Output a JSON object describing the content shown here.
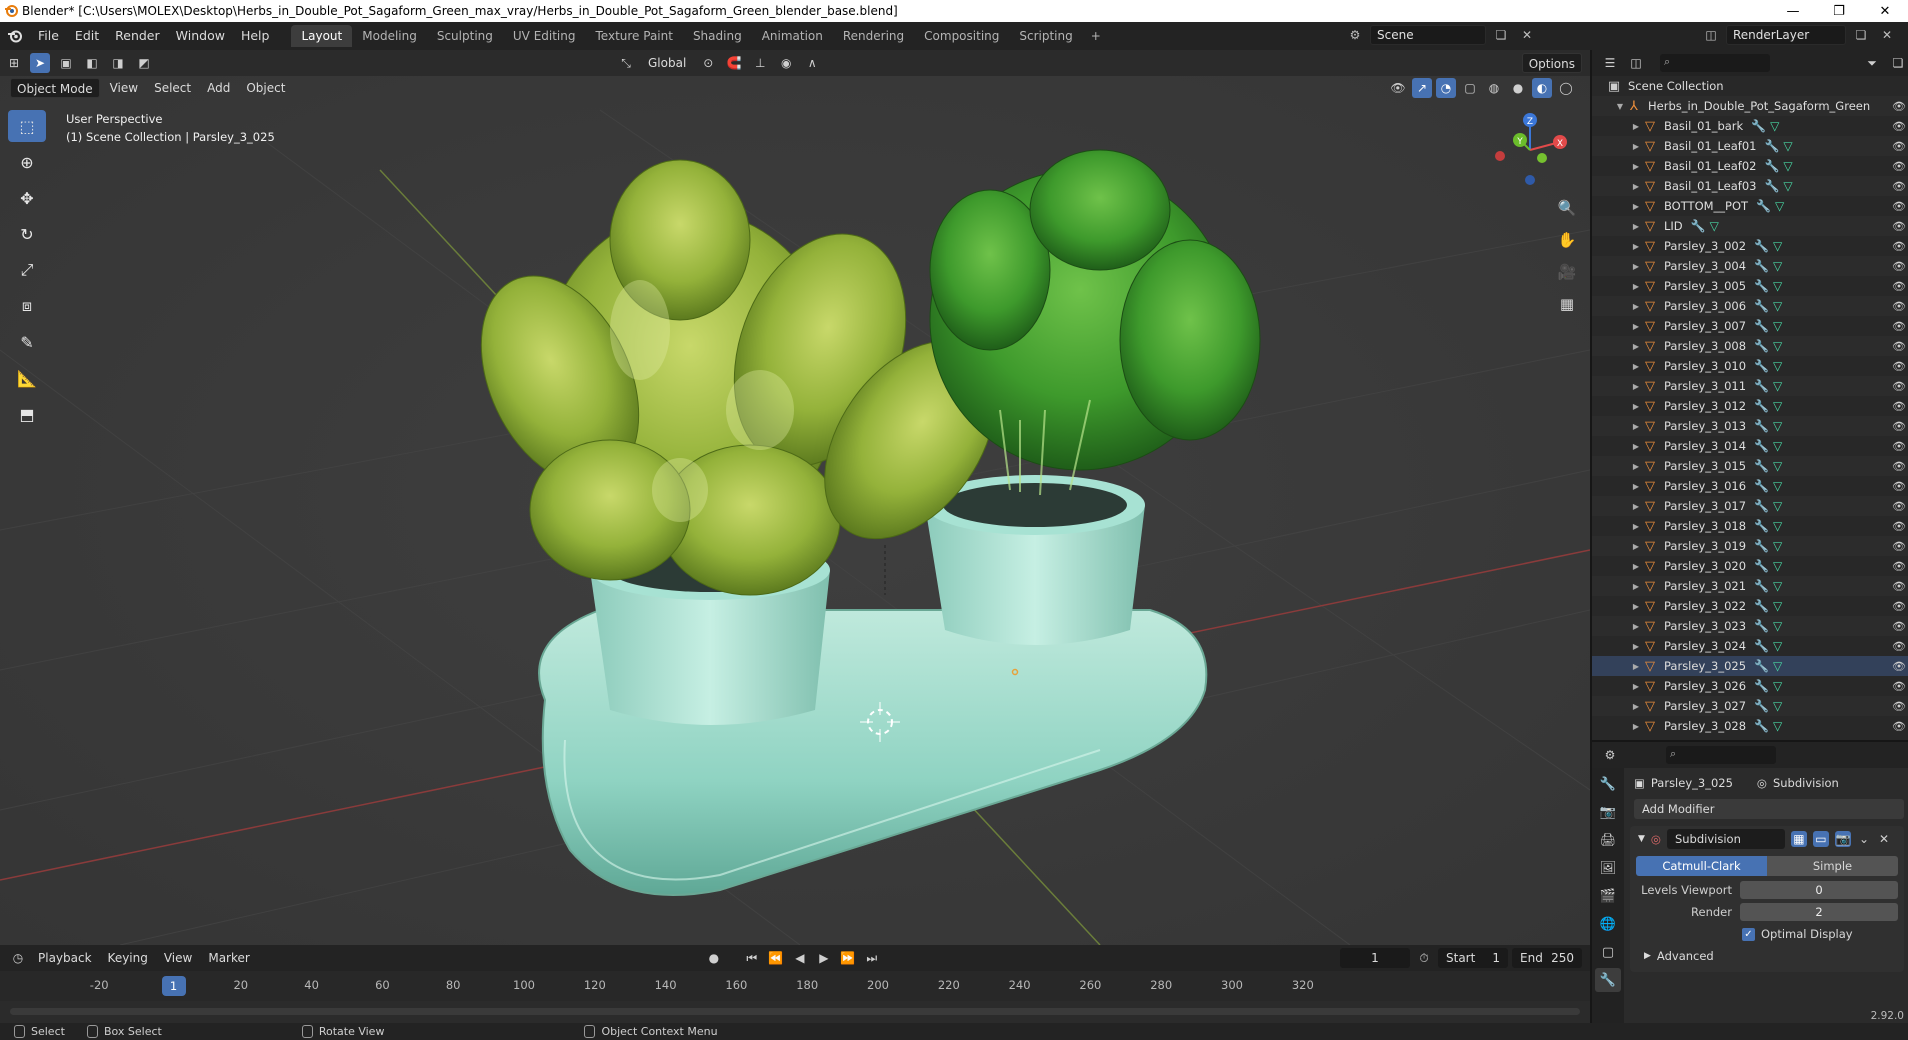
{
  "window": {
    "title": "Blender* [C:\\Users\\MOLEX\\Desktop\\Herbs_in_Double_Pot_Sagaform_Green_max_vray/Herbs_in_Double_Pot_Sagaform_Green_blender_base.blend]",
    "minimize": "—",
    "maximize": "❐",
    "close": "✕"
  },
  "menu": [
    "File",
    "Edit",
    "Render",
    "Window",
    "Help"
  ],
  "workspaces": [
    "Layout",
    "Modeling",
    "Sculpting",
    "UV Editing",
    "Texture Paint",
    "Shading",
    "Animation",
    "Rendering",
    "Compositing",
    "Scripting"
  ],
  "workspace_add": "+",
  "scene": {
    "name": "Scene",
    "render_layer": "RenderLayer"
  },
  "viewport": {
    "mode": "Object Mode",
    "menus": [
      "View",
      "Select",
      "Add",
      "Object"
    ],
    "transform_orientation": "Global",
    "options": "Options",
    "overlay_line1": "User Perspective",
    "overlay_line2": "(1) Scene Collection | Parsley_3_025",
    "gizmo_axes": {
      "z": "Z",
      "y": "Y",
      "x": "X"
    }
  },
  "timeline": {
    "menus": [
      "Playback",
      "Keying",
      "View",
      "Marker"
    ],
    "current_frame": "1",
    "start_label": "Start",
    "start": "1",
    "end_label": "End",
    "end": "250",
    "ticks": [
      "-20",
      "1",
      "20",
      "40",
      "60",
      "80",
      "100",
      "120",
      "140",
      "160",
      "180",
      "200",
      "220",
      "240",
      "260",
      "280",
      "300",
      "320"
    ]
  },
  "statusbar": {
    "select": "Select",
    "box_select": "Box Select",
    "rotate_view": "Rotate View",
    "context_menu": "Object Context Menu",
    "version": "2.92.0"
  },
  "outliner": {
    "root": "Scene Collection",
    "collection": "Herbs_in_Double_Pot_Sagaform_Green",
    "items": [
      "Basil_01_bark",
      "Basil_01_Leaf01",
      "Basil_01_Leaf02",
      "Basil_01_Leaf03",
      "BOTTOM__POT",
      "LID",
      "Parsley_3_002",
      "Parsley_3_004",
      "Parsley_3_005",
      "Parsley_3_006",
      "Parsley_3_007",
      "Parsley_3_008",
      "Parsley_3_010",
      "Parsley_3_011",
      "Parsley_3_012",
      "Parsley_3_013",
      "Parsley_3_014",
      "Parsley_3_015",
      "Parsley_3_016",
      "Parsley_3_017",
      "Parsley_3_018",
      "Parsley_3_019",
      "Parsley_3_020",
      "Parsley_3_021",
      "Parsley_3_022",
      "Parsley_3_023",
      "Parsley_3_024",
      "Parsley_3_025",
      "Parsley_3_026",
      "Parsley_3_027",
      "Parsley_3_028"
    ],
    "selected_item": "Parsley_3_025"
  },
  "properties": {
    "object_name": "Parsley_3_025",
    "modifier_tab": "Subdivision",
    "add_modifier": "Add Modifier",
    "modifier_name": "Subdivision",
    "algo_catmull": "Catmull-Clark",
    "algo_simple": "Simple",
    "levels_viewport_label": "Levels Viewport",
    "levels_viewport": "0",
    "render_label": "Render",
    "render": "2",
    "optimal_display": "Optimal Display",
    "advanced": "Advanced"
  },
  "colors": {
    "accent": "#4772b3",
    "object_icon": "#ee8f3c",
    "mesh_icon": "#48d6a3",
    "viewport_bg": "#393939"
  }
}
